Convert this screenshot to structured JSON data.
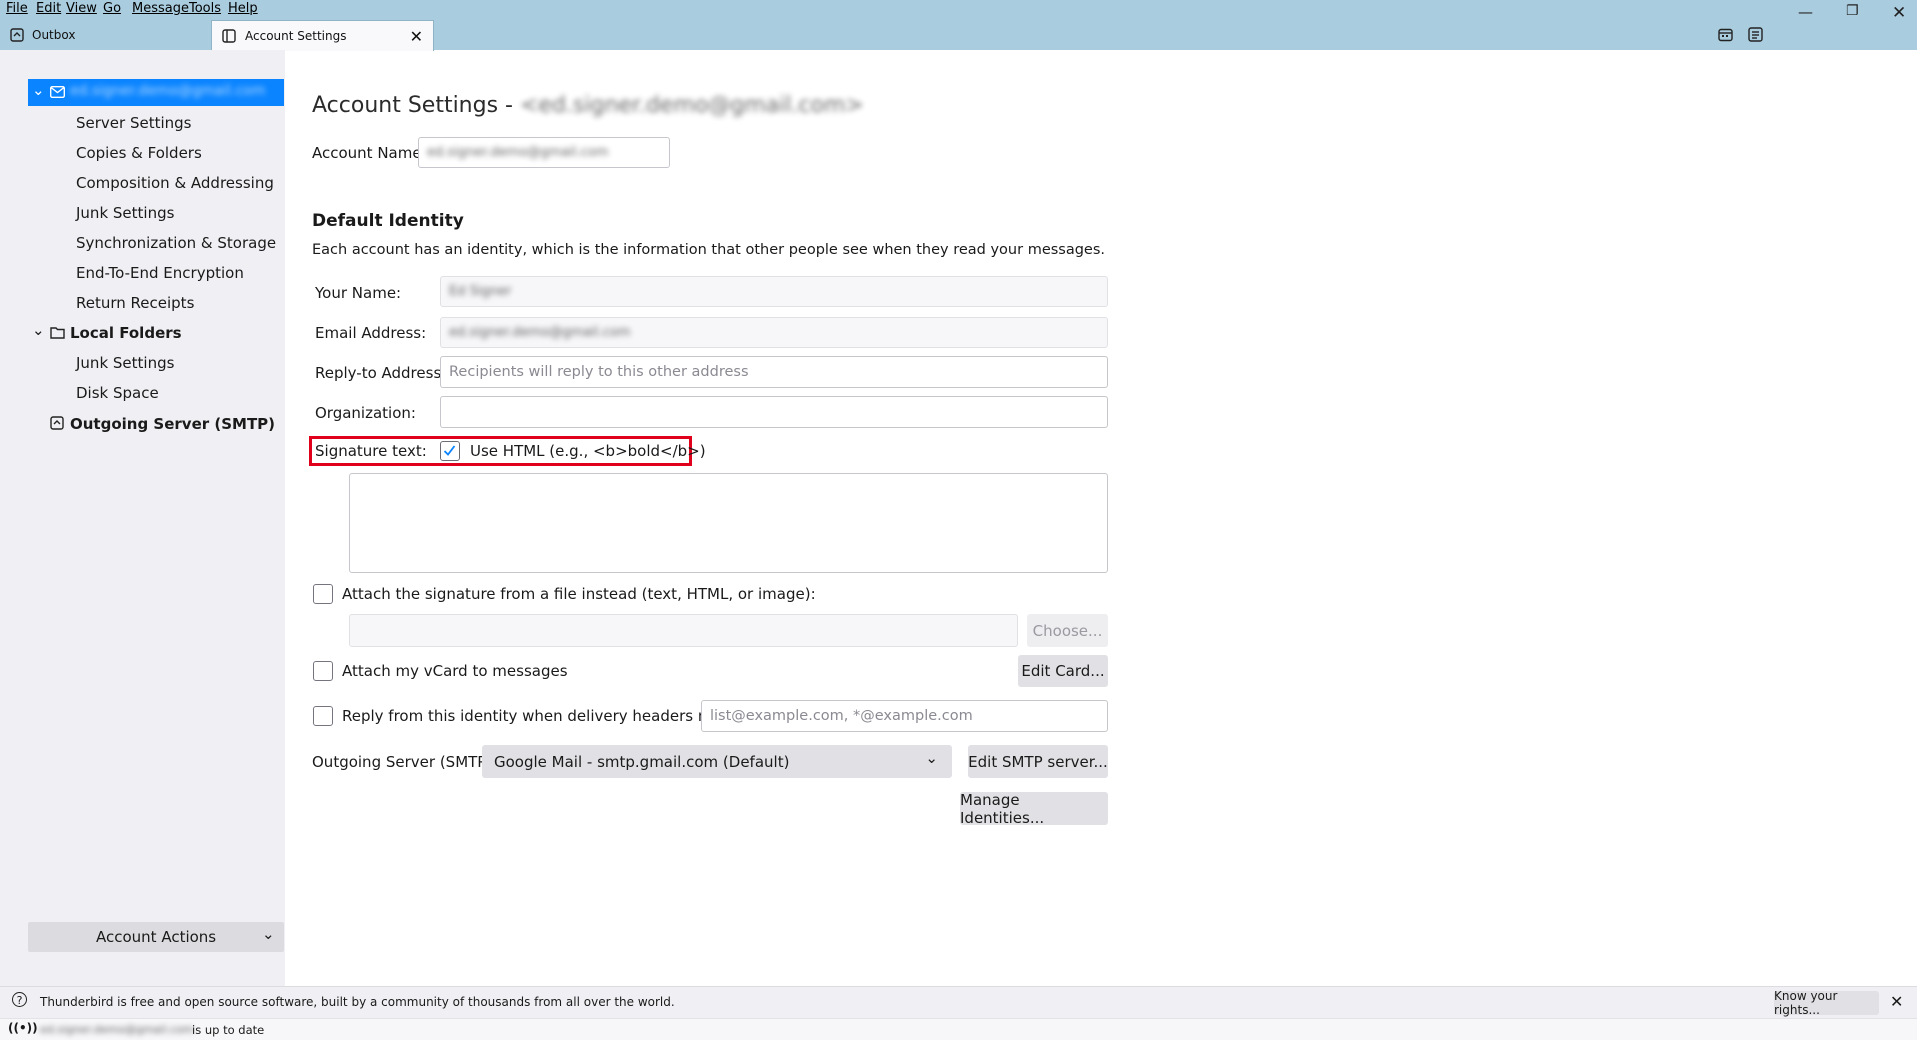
{
  "menu": [
    "File",
    "Edit",
    "View",
    "Go",
    "Message",
    "Tools",
    "Help"
  ],
  "tabs": [
    {
      "label": "Outbox",
      "icon": "outbox-icon"
    },
    {
      "label": "Account Settings",
      "icon": "settings-page-icon",
      "active": true
    }
  ],
  "sidebar": {
    "account_name": "ed.signer.demo@gmail.com",
    "account_items": [
      "Server Settings",
      "Copies & Folders",
      "Composition & Addressing",
      "Junk Settings",
      "Synchronization & Storage",
      "End-To-End Encryption",
      "Return Receipts"
    ],
    "local_folders_label": "Local Folders",
    "local_items": [
      "Junk Settings",
      "Disk Space"
    ],
    "outgoing_label": "Outgoing Server (SMTP)",
    "account_actions_label": "Account Actions"
  },
  "main": {
    "title_prefix": "Account Settings - ",
    "title_account": "<ed.signer.demo@gmail.com>",
    "account_name_label": "Account Name:",
    "account_name_value": "ed.signer.demo@gmail.com",
    "section_title": "Default Identity",
    "section_desc": "Each account has an identity, which is the information that other people see when they read your messages.",
    "your_name_label": "Your Name:",
    "your_name_value": "Ed Signer",
    "email_label": "Email Address:",
    "email_value": "ed.signer.demo@gmail.com",
    "reply_to_label": "Reply-to Address:",
    "reply_to_placeholder": "Recipients will reply to this other address",
    "organization_label": "Organization:",
    "signature_label": "Signature text:",
    "use_html_label": "Use HTML (e.g., <b>bold</b>)",
    "use_html_checked": true,
    "attach_sig_label": "Attach the signature from a file instead (text, HTML, or image):",
    "choose_label": "Choose...",
    "vcard_label": "Attach my vCard to messages",
    "edit_card_label": "Edit Card...",
    "reply_identity_label": "Reply from this identity when delivery headers match:",
    "reply_identity_placeholder": "list@example.com, *@example.com",
    "smtp_label": "Outgoing Server (SMTP):",
    "smtp_value": "Google Mail - smtp.gmail.com (Default)",
    "edit_smtp_label": "Edit SMTP server...",
    "manage_identities_label": "Manage Identities..."
  },
  "notification": {
    "text": "Thunderbird is free and open source software, built by a community of thousands from all over the world.",
    "button": "Know your rights..."
  },
  "status": {
    "account": "ed.signer.demo@gmail.com",
    "text": "is up to date"
  },
  "colors": {
    "accent": "#0a84ff",
    "highlight_box": "#e0001b",
    "titlebar": "#a9ccde"
  }
}
